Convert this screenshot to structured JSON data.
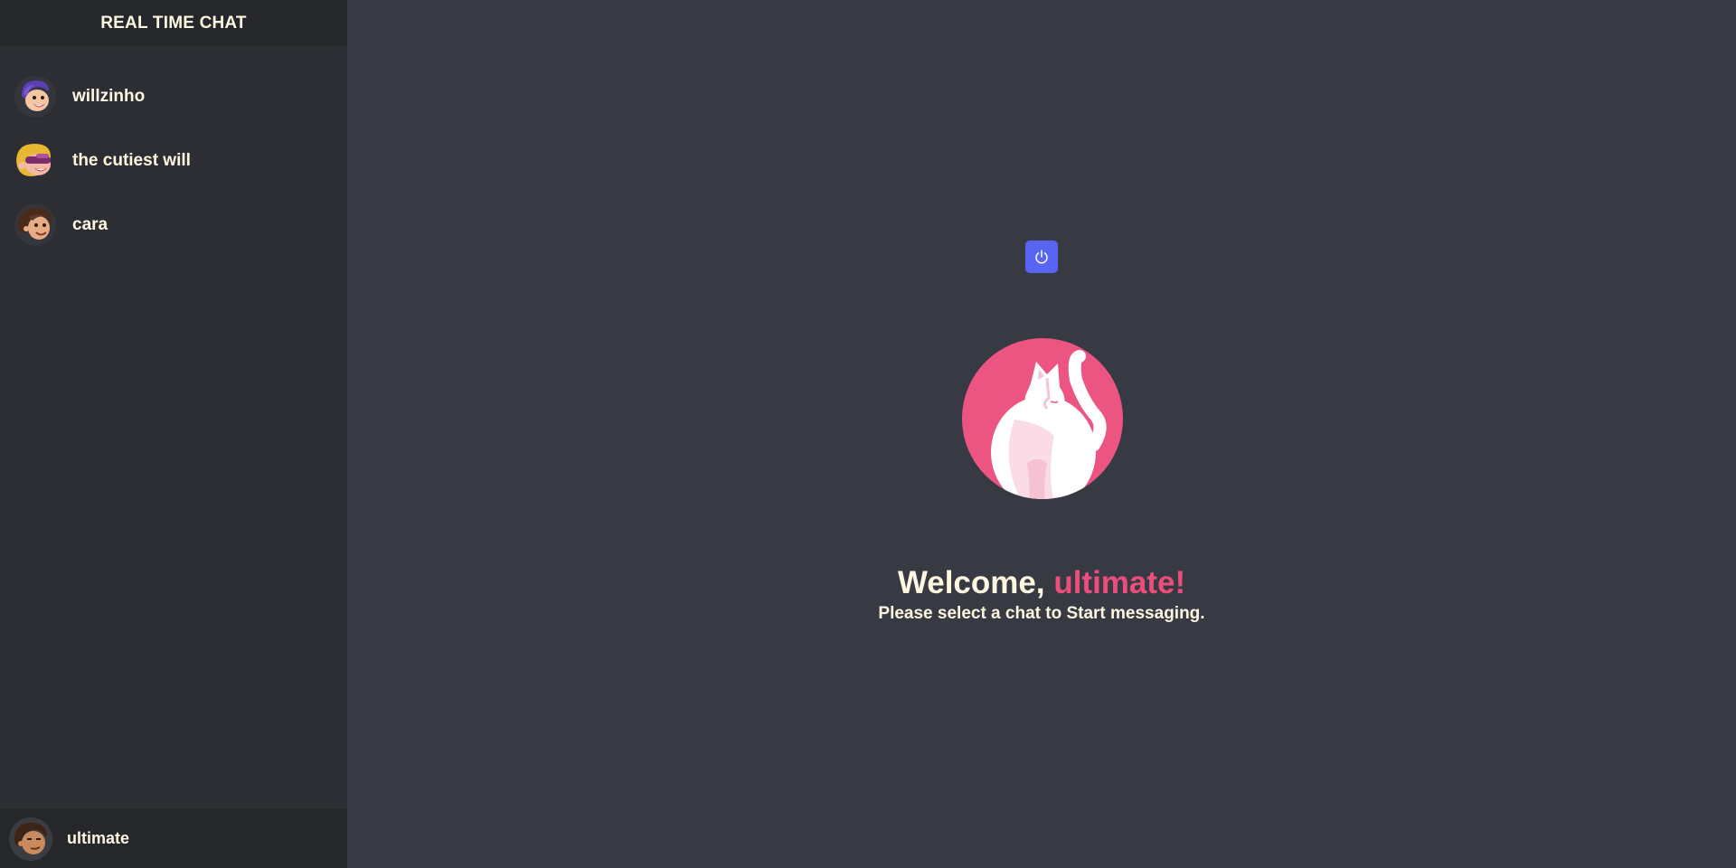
{
  "app": {
    "title": "REAL TIME CHAT"
  },
  "contacts": [
    {
      "name": "willzinho",
      "avatar": "purple-hair-face-avatar"
    },
    {
      "name": "the cutiest will",
      "avatar": "blonde-hair-face-avatar"
    },
    {
      "name": "cara",
      "avatar": "brown-hair-face-avatar"
    }
  ],
  "current_user": {
    "name": "ultimate",
    "avatar": "brown-face-avatar"
  },
  "main": {
    "logout_icon": "power-icon",
    "logo": "white-cat-logo",
    "welcome_prefix": "Welcome, ",
    "welcome_user": "ultimate!",
    "subtitle": "Please select a chat to Start messaging."
  },
  "colors": {
    "background": "#373a42",
    "sidebar": "#2c2e33",
    "header": "#25272b",
    "text": "#fdf6e0",
    "accent_pink": "#ec4e7c",
    "button_blue": "#5865f2"
  }
}
